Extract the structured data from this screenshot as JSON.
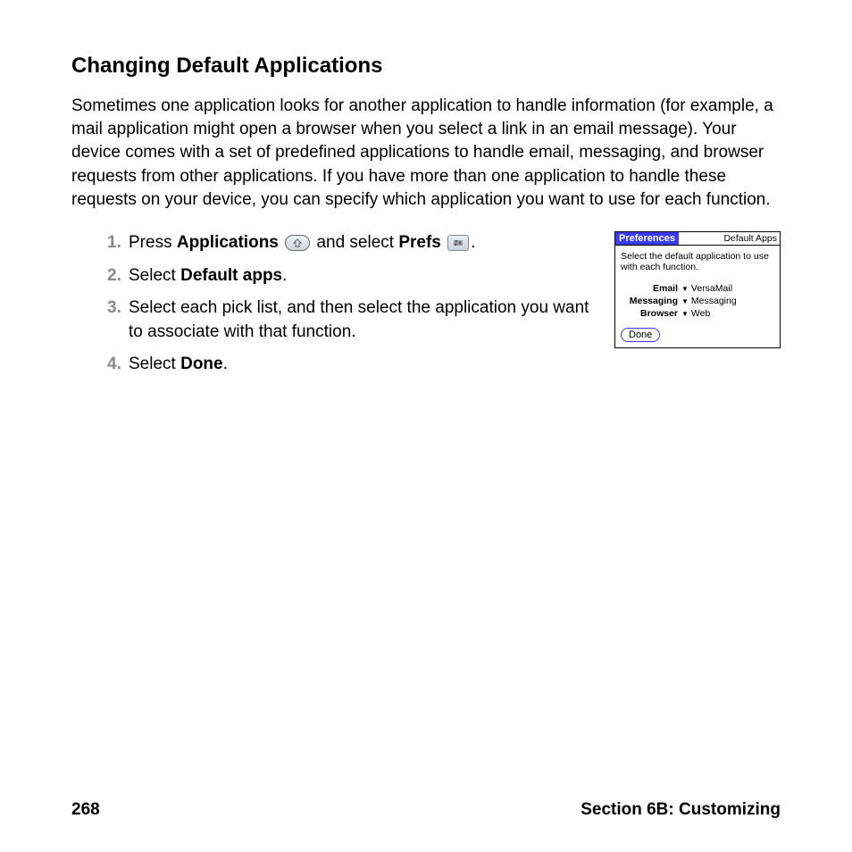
{
  "heading": "Changing Default Applications",
  "intro": "Sometimes one application looks for another application to handle information (for example, a mail application might open a browser when you select a link in an email message). Your device comes with a set of predefined applications to handle email, messaging, and browser requests from other applications. If you have more than one application to handle these requests on your device, you can specify which application you want to use for each function.",
  "steps": [
    {
      "num": "1.",
      "pre": "Press ",
      "bold1": "Applications",
      "mid": " and select ",
      "bold2": "Prefs",
      "post": "."
    },
    {
      "num": "2.",
      "pre": "Select ",
      "bold1": "Default apps",
      "post": "."
    },
    {
      "num": "3.",
      "text": "Select each pick list, and then select the application you want to associate with that function."
    },
    {
      "num": "4.",
      "pre": "Select ",
      "bold1": "Done",
      "post": "."
    }
  ],
  "device": {
    "title_left": "Preferences",
    "title_right": "Default Apps",
    "instruction": "Select the default application to use with each function.",
    "rows": [
      {
        "label": "Email",
        "value": "VersaMail"
      },
      {
        "label": "Messaging",
        "value": "Messaging"
      },
      {
        "label": "Browser",
        "value": "Web"
      }
    ],
    "done": "Done"
  },
  "footer": {
    "page": "268",
    "section": "Section 6B: Customizing"
  }
}
